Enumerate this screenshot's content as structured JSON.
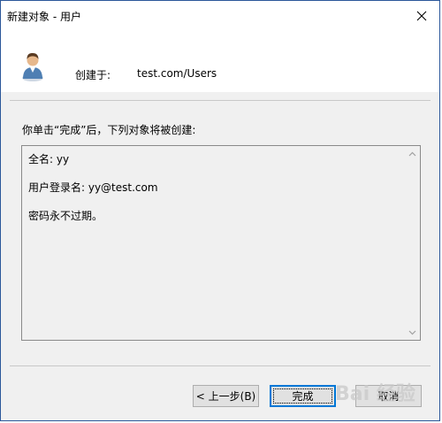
{
  "window": {
    "title": "新建对象 - 用户",
    "close_icon": "close-icon"
  },
  "header": {
    "created_label": "创建于:",
    "created_value": "test.com/Users",
    "icon": "user-icon"
  },
  "info_text": "你单击“完成”后，下列对象将被创建:",
  "summary": {
    "full_name": "全名: yy",
    "logon_name": "用户登录名: yy@test.com",
    "password_note": "密码永不过期。"
  },
  "buttons": {
    "back": "< 上一步(B)",
    "finish": "完成",
    "cancel": "取消"
  },
  "watermark": "Bai 经验",
  "colors": {
    "accent": "#0078d7",
    "border": "#2b579a"
  }
}
